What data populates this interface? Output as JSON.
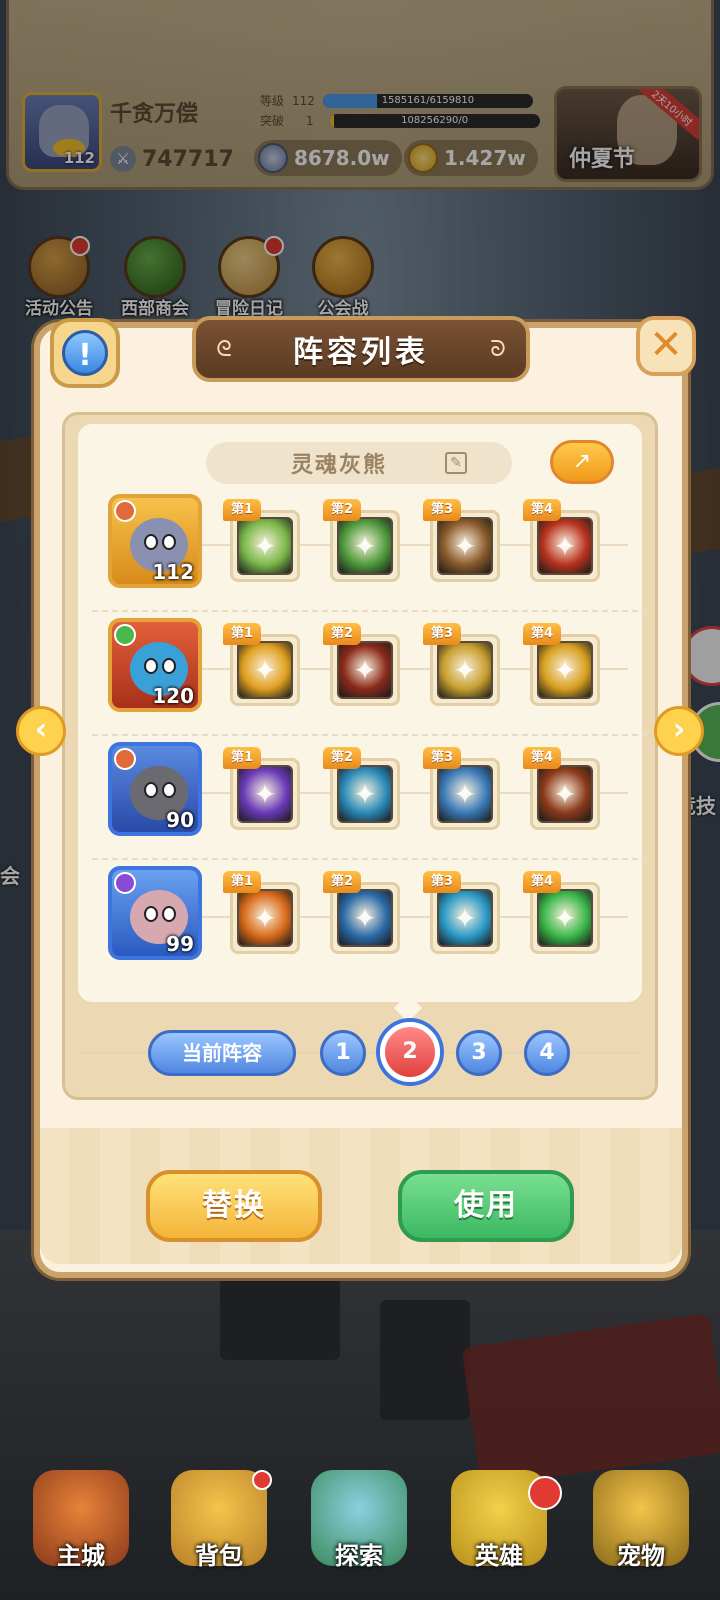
{
  "player": {
    "name": "千贪万偿",
    "level": "112",
    "power": "747717",
    "level_label": "等级",
    "level_value": "112",
    "level_progress_text": "1585161/6159810",
    "level_progress": 0.257,
    "break_label": "突破",
    "break_value": "1",
    "break_progress_text": "108256290/0",
    "break_progress": 0.02
  },
  "currencies": [
    {
      "value": "8678.0w",
      "icon": "silver-coin-icon"
    },
    {
      "value": "1.427w",
      "icon": "gold-coin-icon"
    }
  ],
  "event": {
    "label": "仲夏节",
    "tag": "2天10小时"
  },
  "shortcuts": [
    {
      "label": "活动公告"
    },
    {
      "label": "西部商会"
    },
    {
      "label": "冒险日记"
    },
    {
      "label": "公会战"
    }
  ],
  "modal": {
    "title": "阵容列表",
    "lineup_name": "灵魂灰熊",
    "current_lineup_label": "当前阵容",
    "lineup_tabs": [
      "1",
      "2",
      "3",
      "4"
    ],
    "active_tab": "2",
    "replace_label": "替换",
    "use_label": "使用"
  },
  "heroes": [
    {
      "level": "112",
      "frame_color": "#e3a33a",
      "skills": [
        {
          "badge": "第1",
          "icon": "hammer-sword-icon",
          "color": "#7ab84a"
        },
        {
          "badge": "第2",
          "icon": "star-shield-icon",
          "color": "#4f9a3c"
        },
        {
          "badge": "第3",
          "icon": "shield-slam-icon",
          "color": "#8a5a2a"
        },
        {
          "badge": "第4",
          "icon": "rage-face-icon",
          "color": "#b8321e"
        }
      ]
    },
    {
      "level": "120",
      "frame_color": "#e3a33a",
      "skills": [
        {
          "badge": "第1",
          "icon": "fire-serpent-icon",
          "color": "#e0a020"
        },
        {
          "badge": "第2",
          "icon": "dragon-eye-icon",
          "color": "#8a2a1a"
        },
        {
          "badge": "第3",
          "icon": "fist-strike-icon",
          "color": "#c8a030"
        },
        {
          "badge": "第4",
          "icon": "flame-dragon-icon",
          "color": "#d8a020"
        }
      ]
    },
    {
      "level": "90",
      "frame_color": "#3e74e0",
      "skills": [
        {
          "badge": "第1",
          "icon": "arcane-circle-icon",
          "color": "#6a3ab8"
        },
        {
          "badge": "第2",
          "icon": "leaf-swirl-icon",
          "color": "#2a8ab8"
        },
        {
          "badge": "第3",
          "icon": "tree-spirit-icon",
          "color": "#3a7ab8"
        },
        {
          "badge": "第4",
          "icon": "bomb-icon",
          "color": "#8a3a1a"
        }
      ]
    },
    {
      "level": "99",
      "frame_color": "#3e74e0",
      "skills": [
        {
          "badge": "第1",
          "icon": "power-fist-icon",
          "color": "#d86a1a"
        },
        {
          "badge": "第2",
          "icon": "red-mask-icon",
          "color": "#2a6aa8"
        },
        {
          "badge": "第3",
          "icon": "trident-icon",
          "color": "#2a9ac8"
        },
        {
          "badge": "第4",
          "icon": "healing-cloud-icon",
          "color": "#3ab84a"
        }
      ]
    }
  ],
  "bottom_nav": [
    {
      "label": "主城",
      "icon": "castle-icon"
    },
    {
      "label": "背包",
      "icon": "backpack-icon"
    },
    {
      "label": "探索",
      "icon": "map-icon"
    },
    {
      "label": "英雄",
      "icon": "hero-icon"
    },
    {
      "label": "宠物",
      "icon": "pet-icon"
    }
  ],
  "side_labels": {
    "left": "会",
    "right": "竞技"
  },
  "colors": {
    "accent_orange": "#f3b43a",
    "accent_green": "#3bb862",
    "accent_blue": "#4f86e0",
    "active_red": "#e0413f",
    "panel_bg": "#fbf1de"
  }
}
